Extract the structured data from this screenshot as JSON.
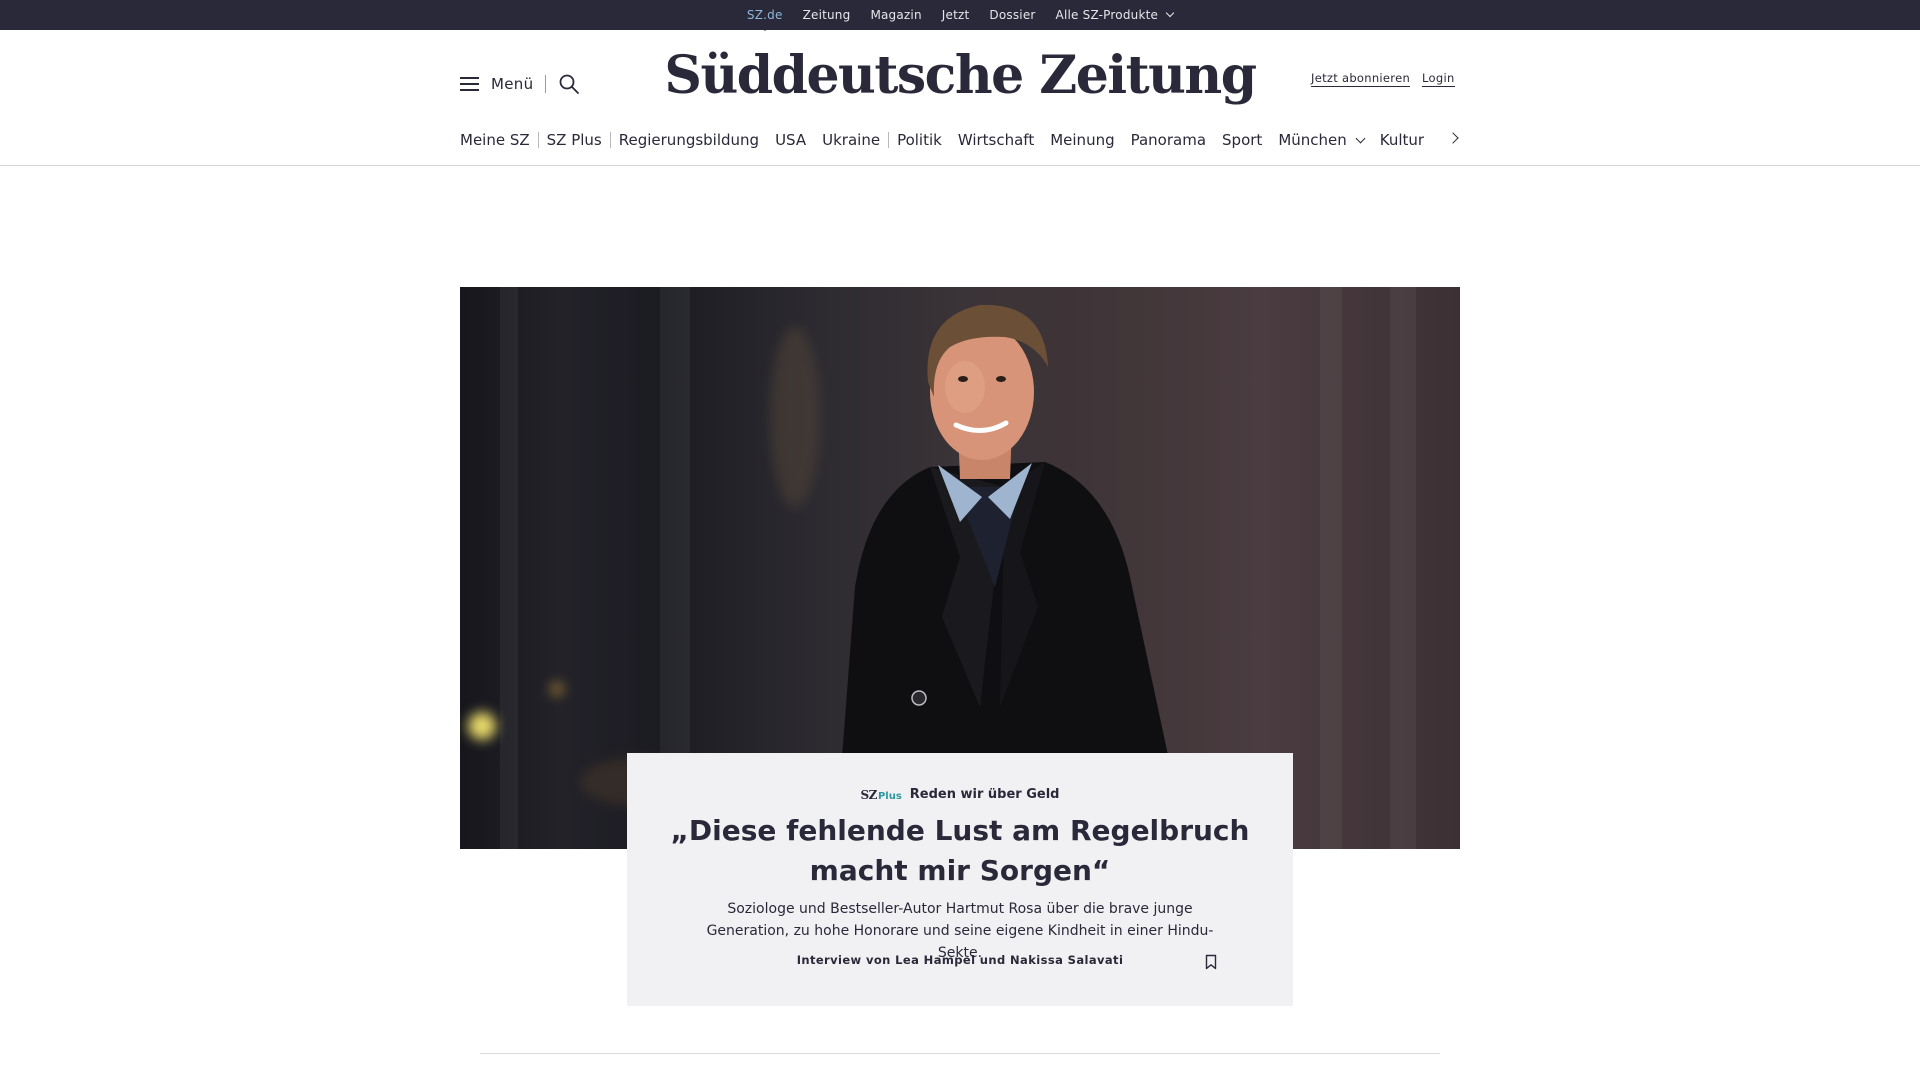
{
  "topbar": {
    "links": [
      "SZ.de",
      "Zeitung",
      "Magazin",
      "Jetzt",
      "Dossier",
      "Alle SZ-Produkte"
    ]
  },
  "header": {
    "menu_label": "Menü",
    "logo": "Süddeutsche Zeitung",
    "subscribe": "Jetzt abonnieren",
    "login": "Login"
  },
  "nav": {
    "items": [
      "Meine SZ",
      "SZ Plus",
      "Regierungsbildung",
      "USA",
      "Ukraine",
      "Politik",
      "Wirtschaft",
      "Meinung",
      "Panorama",
      "Sport",
      "München",
      "Kultur"
    ]
  },
  "article": {
    "brand_sz": "SZ",
    "brand_plus": "Plus",
    "kicker": "Reden wir über Geld",
    "headline": "„Diese fehlende Lust am Regelbruch macht mir Sorgen“",
    "teaser": "Soziologe und Bestseller-Autor Hartmut Rosa über die brave junge Generation, zu hohe Honorare und seine eigene Kindheit in einer Hindu-Sekte.",
    "byline": "Interview von Lea Hampel und Nakissa Salavati"
  },
  "colors": {
    "topbar_bg": "#29293a",
    "text": "#29293a",
    "active_link": "#8fb6d8",
    "plus_accent": "#2b9aa0",
    "card_bg": "#f1f1f3"
  },
  "icons": [
    "hamburger-icon",
    "search-icon",
    "chevron-down-icon",
    "chevron-right-icon",
    "bookmark-icon"
  ]
}
